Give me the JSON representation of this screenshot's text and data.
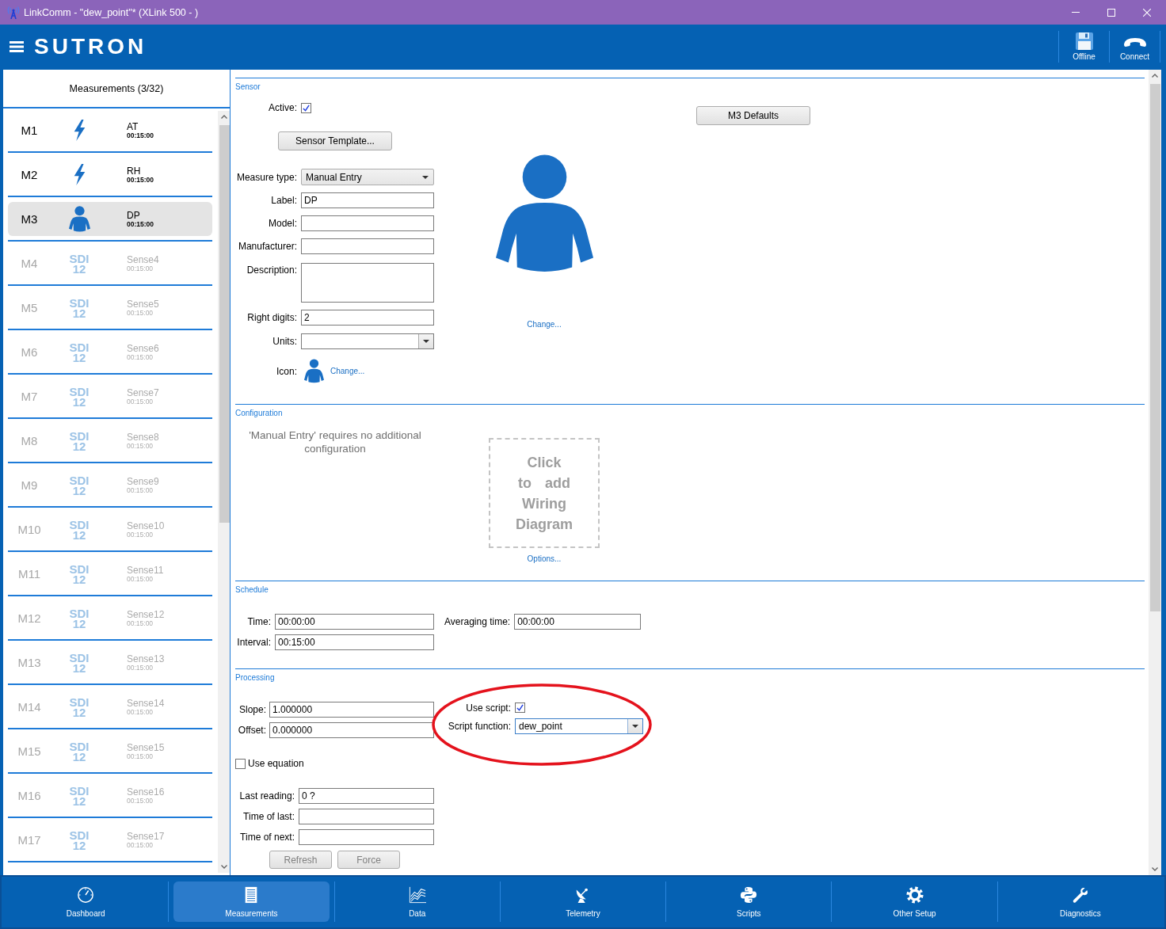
{
  "window": {
    "title": "LinkComm - \"dew_point\"* (XLink 500 - )"
  },
  "app_bar": {
    "logo": "SUTRON",
    "actions": [
      {
        "label": "Offline"
      },
      {
        "label": "Connect"
      }
    ]
  },
  "sidebar": {
    "title": "Measurements (3/32)",
    "items": [
      {
        "id": "M1",
        "kind": "bolt",
        "name": "AT",
        "interval": "00:15:00",
        "active": true,
        "selected": false
      },
      {
        "id": "M2",
        "kind": "bolt",
        "name": "RH",
        "interval": "00:15:00",
        "active": true,
        "selected": false
      },
      {
        "id": "M3",
        "kind": "manual",
        "name": "DP",
        "interval": "00:15:00",
        "active": true,
        "selected": true
      },
      {
        "id": "M4",
        "kind": "sdi12",
        "badge": "SDI 12",
        "name": "Sense4",
        "interval": "00:15:00",
        "active": false,
        "selected": false
      },
      {
        "id": "M5",
        "kind": "sdi12",
        "badge": "SDI 12",
        "name": "Sense5",
        "interval": "00:15:00",
        "active": false,
        "selected": false
      },
      {
        "id": "M6",
        "kind": "sdi12",
        "badge": "SDI 12",
        "name": "Sense6",
        "interval": "00:15:00",
        "active": false,
        "selected": false
      },
      {
        "id": "M7",
        "kind": "sdi12",
        "badge": "SDI 12",
        "name": "Sense7",
        "interval": "00:15:00",
        "active": false,
        "selected": false
      },
      {
        "id": "M8",
        "kind": "sdi12",
        "badge": "SDI 12",
        "name": "Sense8",
        "interval": "00:15:00",
        "active": false,
        "selected": false
      },
      {
        "id": "M9",
        "kind": "sdi12",
        "badge": "SDI 12",
        "name": "Sense9",
        "interval": "00:15:00",
        "active": false,
        "selected": false
      },
      {
        "id": "M10",
        "kind": "sdi12",
        "badge": "SDI 12",
        "name": "Sense10",
        "interval": "00:15:00",
        "active": false,
        "selected": false
      },
      {
        "id": "M11",
        "kind": "sdi12",
        "badge": "SDI 12",
        "name": "Sense11",
        "interval": "00:15:00",
        "active": false,
        "selected": false
      },
      {
        "id": "M12",
        "kind": "sdi12",
        "badge": "SDI 12",
        "name": "Sense12",
        "interval": "00:15:00",
        "active": false,
        "selected": false
      },
      {
        "id": "M13",
        "kind": "sdi12",
        "badge": "SDI 12",
        "name": "Sense13",
        "interval": "00:15:00",
        "active": false,
        "selected": false
      },
      {
        "id": "M14",
        "kind": "sdi12",
        "badge": "SDI 12",
        "name": "Sense14",
        "interval": "00:15:00",
        "active": false,
        "selected": false
      },
      {
        "id": "M15",
        "kind": "sdi12",
        "badge": "SDI 12",
        "name": "Sense15",
        "interval": "00:15:00",
        "active": false,
        "selected": false
      },
      {
        "id": "M16",
        "kind": "sdi12",
        "badge": "SDI 12",
        "name": "Sense16",
        "interval": "00:15:00",
        "active": false,
        "selected": false
      },
      {
        "id": "M17",
        "kind": "sdi12",
        "badge": "SDI 12",
        "name": "Sense17",
        "interval": "00:15:00",
        "active": false,
        "selected": false
      }
    ]
  },
  "sensor": {
    "heading": "Sensor",
    "active": {
      "label": "Active:",
      "checked": true
    },
    "template_button": "Sensor Template...",
    "fields": [
      {
        "kind": "dropdown",
        "label": "Measure type:",
        "value": "Manual Entry"
      },
      {
        "kind": "text",
        "label": "Label:",
        "value": "DP"
      },
      {
        "kind": "text",
        "label": "Model:"
      },
      {
        "kind": "text",
        "label": "Manufacturer:"
      },
      {
        "kind": "textarea",
        "label": "Description:"
      },
      {
        "kind": "text",
        "label": "Right digits:",
        "value": "2"
      },
      {
        "kind": "combo",
        "label": "Units:"
      },
      {
        "kind": "icon",
        "label": "Icon:",
        "link": "Change..."
      }
    ],
    "picture_link": "Change...",
    "defaults_button": "M3 Defaults"
  },
  "configuration": {
    "heading": "Configuration",
    "message": "'Manual Entry' requires no additional configuration",
    "wiring_placeholder": "Click to add Wiring Diagram",
    "options_link": "Options..."
  },
  "schedule": {
    "heading": "Schedule",
    "fields": [
      {
        "label": "Time:",
        "value": "00:00:00"
      },
      {
        "label": "Averaging time:",
        "value": "00:00:00"
      },
      {
        "label": "Interval:",
        "value": "00:15:00"
      }
    ]
  },
  "processing": {
    "heading": "Processing",
    "fields": [
      {
        "label": "Slope:",
        "value": "1.000000"
      },
      {
        "label": "Offset:",
        "value": "0.000000"
      }
    ],
    "use_script": {
      "label": "Use script:",
      "checked": true
    },
    "script_function": {
      "label": "Script function:",
      "value": "dew_point",
      "focused": true
    },
    "use_equation": {
      "label": "Use equation",
      "checked": false
    },
    "readings": [
      {
        "label": "Last reading:",
        "value": "0 ?"
      },
      {
        "label": "Time of last:"
      },
      {
        "label": "Time of next:"
      }
    ],
    "buttons": [
      {
        "label": "Refresh",
        "disabled": true
      },
      {
        "label": "Force",
        "disabled": true
      }
    ],
    "highlight": true
  },
  "bottom_nav": [
    {
      "label": "Dashboard",
      "selected": false
    },
    {
      "label": "Measurements",
      "selected": true
    },
    {
      "label": "Data",
      "selected": false
    },
    {
      "label": "Telemetry",
      "selected": false
    },
    {
      "label": "Scripts",
      "selected": false
    },
    {
      "label": "Other Setup",
      "selected": false
    },
    {
      "label": "Diagnostics",
      "selected": false
    }
  ]
}
